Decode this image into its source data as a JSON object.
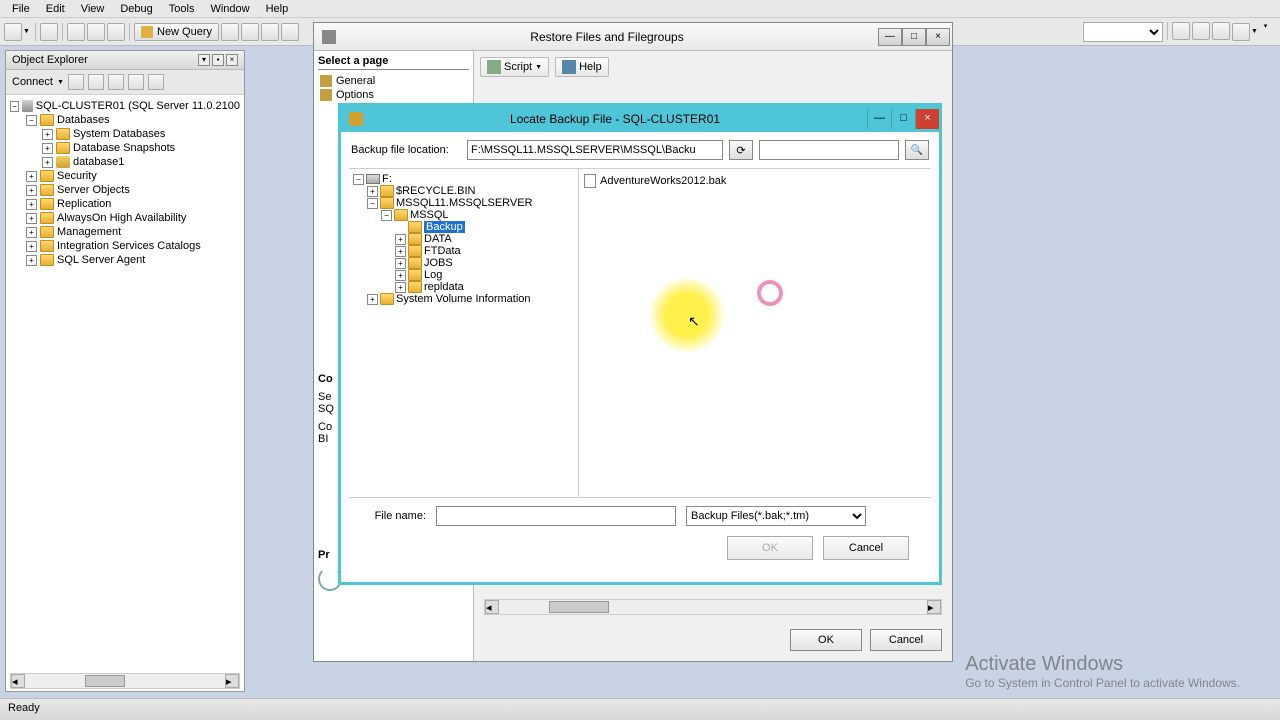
{
  "menu": {
    "file": "File",
    "edit": "Edit",
    "view": "View",
    "debug": "Debug",
    "tools": "Tools",
    "window": "Window",
    "help": "Help"
  },
  "toolbar": {
    "new_query": "New Query"
  },
  "object_explorer": {
    "title": "Object Explorer",
    "connect": "Connect",
    "server": "SQL-CLUSTER01 (SQL Server 11.0.2100",
    "nodes": {
      "databases": "Databases",
      "system_dbs": "System Databases",
      "db_snapshots": "Database Snapshots",
      "database1": "database1",
      "security": "Security",
      "server_objects": "Server Objects",
      "replication": "Replication",
      "alwayson": "AlwaysOn High Availability",
      "management": "Management",
      "isc": "Integration Services Catalogs",
      "agent": "SQL Server Agent"
    }
  },
  "restore": {
    "title": "Restore Files and Filegroups",
    "select_page": "Select a page",
    "general": "General",
    "options": "Options",
    "script": "Script",
    "help": "Help",
    "connection": "Co",
    "server_lbl": "Se",
    "server_val": "SQ",
    "conn_lbl": "Co",
    "conn_val": "BI",
    "progress": "Pr",
    "ok": "OK",
    "cancel": "Cancel"
  },
  "locate": {
    "title": "Locate Backup File - SQL-CLUSTER01",
    "path_label": "Backup file location:",
    "path_value": "F:\\MSSQL11.MSSQLSERVER\\MSSQL\\Backu",
    "tree": {
      "drive": "F:",
      "recycle": "$RECYCLE.BIN",
      "mssql_server": "MSSQL11.MSSQLSERVER",
      "mssql": "MSSQL",
      "backup": "Backup",
      "data": "DATA",
      "ftdata": "FTData",
      "jobs": "JOBS",
      "log": "Log",
      "repldata": "repldata",
      "svi": "System Volume Information"
    },
    "file": "AdventureWorks2012.bak",
    "file_name_label": "File name:",
    "filter": "Backup Files(*.bak;*.tm)",
    "ok": "OK",
    "cancel": "Cancel"
  },
  "watermark": {
    "title": "Activate Windows",
    "sub": "Go to System in Control Panel to activate Windows."
  },
  "status": "Ready"
}
